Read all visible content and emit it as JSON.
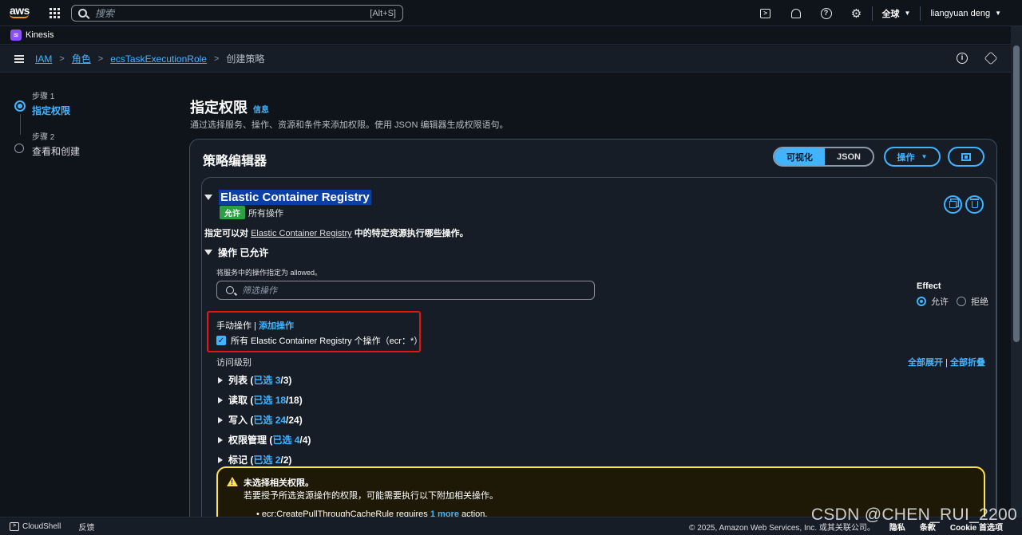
{
  "topnav": {
    "logo_text": "aws",
    "search_placeholder": "搜索",
    "search_shortcut": "[Alt+S]",
    "region": "全球",
    "user": "liangyuan deng",
    "icons": [
      "cloudshell-icon",
      "bell-icon",
      "help-icon",
      "gear-icon"
    ]
  },
  "service_bar": {
    "service": "Kinesis"
  },
  "breadcrumb": {
    "items": [
      "IAM",
      "角色",
      "ecsTaskExecutionRole"
    ],
    "current": "创建策略"
  },
  "steps": [
    {
      "num": "步骤 1",
      "name": "指定权限",
      "active": true
    },
    {
      "num": "步骤 2",
      "name": "查看和创建",
      "active": false
    }
  ],
  "header": {
    "title": "指定权限",
    "info": "信息",
    "description": "通过选择服务、操作、资源和条件来添加权限。使用 JSON 编辑器生成权限语句。"
  },
  "editor": {
    "title": "策略编辑器",
    "toggle_visual": "可视化",
    "toggle_json": "JSON",
    "actions_button": "操作"
  },
  "statement": {
    "service": "Elastic Container Registry",
    "effect_badge": "允许",
    "effect_scope": "所有操作",
    "spec_prefix": "指定可以对",
    "spec_service": "Elastic Container Registry",
    "spec_suffix": "中的特定资源执行哪些操作。",
    "ops_heading": "操作 已允许",
    "ops_hint": "将服务中的操作指定为 allowed。",
    "filter_placeholder": "筛选操作",
    "effect_label": "Effect",
    "effect_allow": "允许",
    "effect_deny": "拒绝",
    "manual_prefix": "手动操作 |",
    "manual_link": "添加操作",
    "all_actions": "所有 Elastic Container Registry 个操作（ecr：*）",
    "access_level": "访问级别",
    "expand_all": "全部展开",
    "collapse_all": "全部折叠",
    "levels": [
      {
        "name": "列表",
        "selected": "已选 3",
        "total": "/3)"
      },
      {
        "name": "读取",
        "selected": "已选 18",
        "total": "/18)"
      },
      {
        "name": "写入",
        "selected": "已选 24",
        "total": "/24)"
      },
      {
        "name": "权限管理",
        "selected": "已选 4",
        "total": "/4)"
      },
      {
        "name": "标记",
        "selected": "已选 2",
        "total": "/2)"
      }
    ],
    "alert": {
      "title": "未选择相关权限。",
      "body": "若要授予所选资源操作的权限，可能需要执行以下附加相关操作。",
      "item_prefix": "ecr:CreatePullThroughCacheRule requires",
      "item_link": "1 more",
      "item_suffix": "action."
    }
  },
  "footer": {
    "cloudshell": "CloudShell",
    "feedback": "反馈",
    "copyright": "© 2025, Amazon Web Services, Inc. 或其关联公司。",
    "privacy": "隐私",
    "terms": "条款",
    "cookie": "Cookie 首选项"
  },
  "watermark": "CSDN @CHEN_RUI_2200"
}
